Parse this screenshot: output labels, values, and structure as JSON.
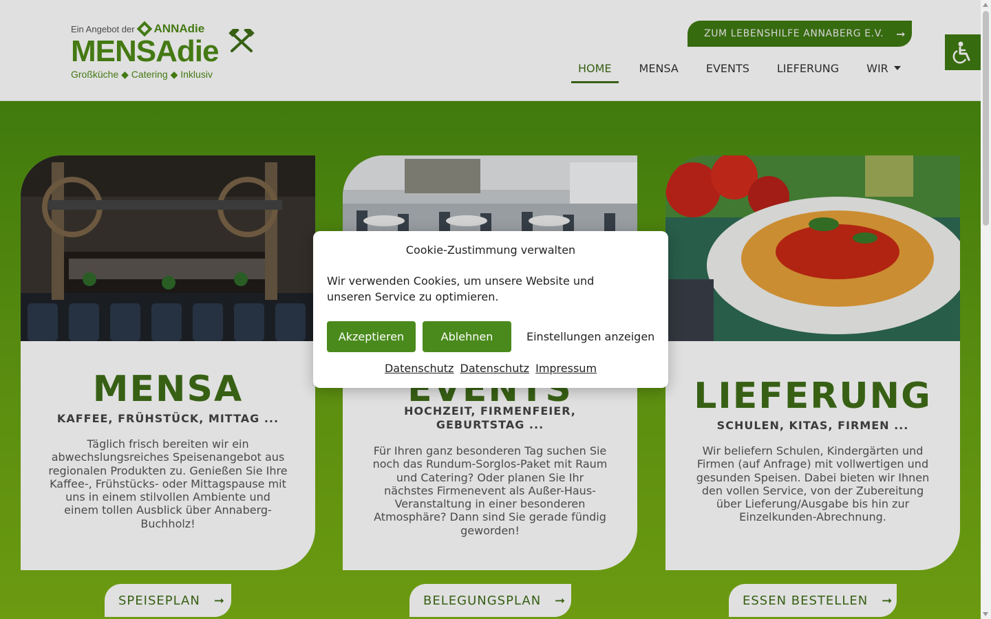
{
  "brand": {
    "tagline_prefix": "Ein Angebot der",
    "tagline_org": "ANNAdie",
    "name": "MENSAdie",
    "subline": "Großküche ◆ Catering ◆ Inklusiv"
  },
  "header": {
    "top_button_label": "ZUM LEBENSHILFE ANNABERG E.V.",
    "nav": [
      {
        "label": "HOME",
        "active": true
      },
      {
        "label": "MENSA"
      },
      {
        "label": "EVENTS"
      },
      {
        "label": "LIEFERUNG"
      },
      {
        "label": "WIR"
      }
    ]
  },
  "cards": [
    {
      "title": "MENSA",
      "subtitle": "KAFFEE, FRÜHSTÜCK, MITTAG ...",
      "text": "Täglich frisch bereiten wir ein abwechslungsreiches Speisenangebot aus regionalen Produkten zu. Genießen Sie Ihre Kaffee-, Frühstücks- oder Mittagspause mit uns in einem stilvollen Ambiente und einem tollen Ausblick über Annaberg-Buchholz!",
      "button": "SPEISEPLAN"
    },
    {
      "title": "EVENTS",
      "subtitle": "HOCHZEIT, FIRMENFEIER, GEBURTSTAG ...",
      "text": "Für Ihren ganz besonderen Tag suchen Sie noch das Rundum-Sorglos-Paket mit Raum und Catering? Oder planen Sie Ihr nächstes Firmenevent als Außer-Haus-Veranstaltung in einer besonderen Atmosphäre? Dann sind Sie gerade fündig geworden!",
      "button": "BELEGUNGSPLAN"
    },
    {
      "title": "LIEFERUNG",
      "subtitle": "SCHULEN, KITAS, FIRMEN ...",
      "text": "Wir beliefern Schulen, Kindergärten und Firmen (auf Anfrage) mit vollwertigen und gesunden Speisen. Dabei bieten wir Ihnen den vollen Service, von der Zubereitung über Lieferung/Ausgabe bis hin zur Einzelkunden-Abrechnung.",
      "button": "ESSEN BESTELLEN"
    }
  ],
  "cookie": {
    "title": "Cookie-Zustimmung verwalten",
    "message": "Wir verwenden Cookies, um unsere Website und unseren Service zu optimieren.",
    "accept": "Akzeptieren",
    "deny": "Ablehnen",
    "settings": "Einstellungen anzeigen",
    "links": [
      "Datenschutz",
      "Datenschutz",
      "Impressum"
    ]
  },
  "colors": {
    "brand_green": "#4e8a16",
    "dark_green": "#3f6e17"
  },
  "icons": {
    "accessibility": "accessibility-icon",
    "arrow": "arrow-right-icon",
    "hammers": "crossed-hammers-icon"
  }
}
